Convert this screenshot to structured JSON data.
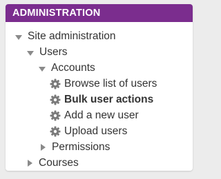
{
  "block": {
    "title": "ADMINISTRATION",
    "accent_color": "#7b2d8e"
  },
  "tree": {
    "site_admin": "Site administration",
    "users": "Users",
    "accounts": "Accounts",
    "browse_users": "Browse list of users",
    "bulk_actions": "Bulk user actions",
    "add_user": "Add a new user",
    "upload_users": "Upload users",
    "permissions": "Permissions",
    "courses": "Courses"
  },
  "icons": {
    "expanded": "caret-down-icon",
    "collapsed": "caret-right-icon",
    "leaf": "gear-icon"
  }
}
